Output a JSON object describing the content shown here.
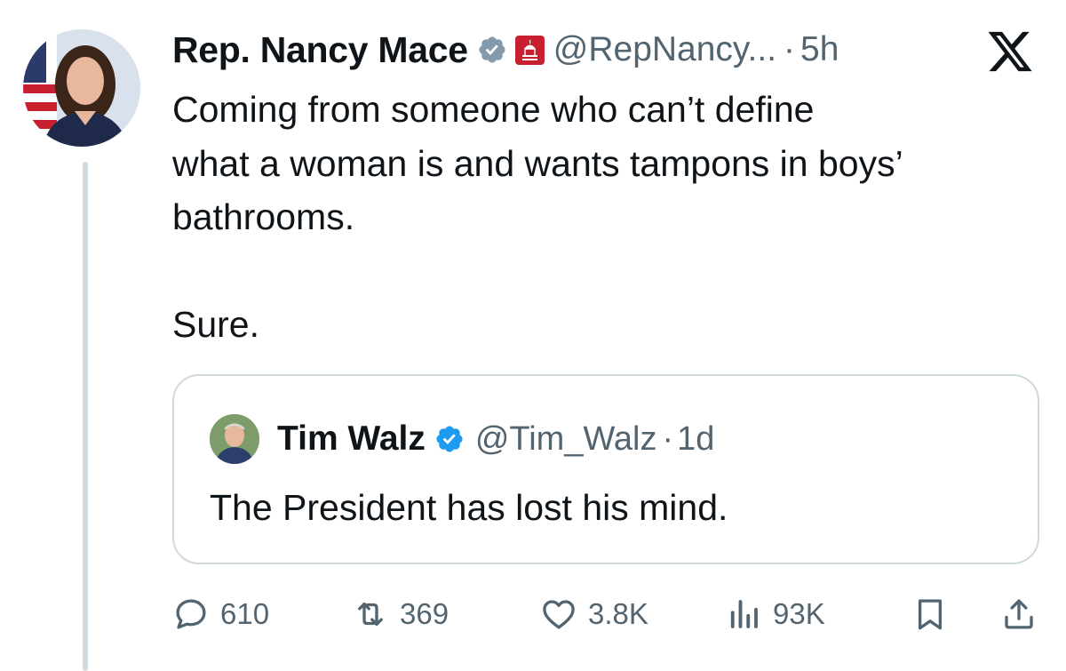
{
  "tweet": {
    "author_name": "Rep. Nancy Mace",
    "handle": "@RepNancy...",
    "separator": "·",
    "time": "5h",
    "lines": [
      "Coming from someone who can’t define",
      "what a woman is and wants tampons in boys’",
      "bathrooms."
    ],
    "line2": "Sure."
  },
  "quoted": {
    "author_name": "Tim Walz",
    "handle": "@Tim_Walz",
    "separator": "·",
    "time": "1d",
    "text": "The President has lost his mind."
  },
  "actions": {
    "replies": "610",
    "reposts": "369",
    "likes": "3.8K",
    "views": "93K"
  },
  "icons": {
    "verified": "verified-badge-icon",
    "affiliation": "house-gop-icon",
    "platform": "x-logo-icon"
  },
  "colors": {
    "verified_blue": "#1d9bf0",
    "verified_gray": "#829aab",
    "secondary_text": "#536471",
    "border": "#cfd9de",
    "affiliation_red": "#c8202f"
  }
}
